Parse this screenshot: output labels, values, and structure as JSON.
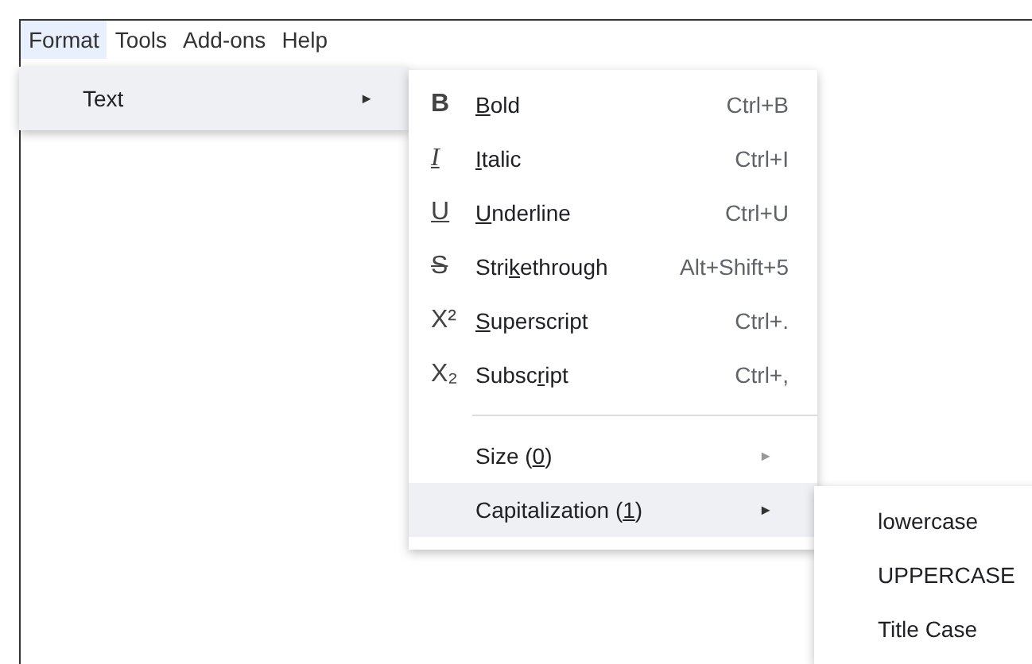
{
  "menubar": [
    {
      "label": "Format",
      "selected": true
    },
    {
      "label": "Tools",
      "selected": false
    },
    {
      "label": "Add-ons",
      "selected": false
    },
    {
      "label": "Help",
      "selected": false
    }
  ],
  "format_menu": [
    {
      "label": "Text",
      "selected": true,
      "arrow": "►"
    }
  ],
  "text_menu": [
    {
      "kind": "item",
      "icon": {
        "kind": "bold",
        "text": "B"
      },
      "key": "B",
      "post": "old",
      "shortcut": "Ctrl+B",
      "selected": false
    },
    {
      "kind": "item",
      "icon": {
        "kind": "italic",
        "text": "I"
      },
      "key": "I",
      "post": "talic",
      "shortcut": "Ctrl+I",
      "selected": false
    },
    {
      "kind": "item",
      "icon": {
        "kind": "underline",
        "text": "U"
      },
      "key": "U",
      "post": "nderline",
      "shortcut": "Ctrl+U",
      "selected": false
    },
    {
      "kind": "item",
      "icon": {
        "kind": "strike",
        "text": "S"
      },
      "pre": "Stri",
      "key": "k",
      "post": "ethrough",
      "shortcut": "Alt+Shift+5",
      "selected": false
    },
    {
      "kind": "item",
      "icon": {
        "kind": "plain",
        "text": "X²"
      },
      "key": "S",
      "post": "uperscript",
      "shortcut": "Ctrl+.",
      "selected": false
    },
    {
      "kind": "item",
      "icon": {
        "kind": "plain",
        "text": "X₂"
      },
      "pre": "Subsc",
      "key": "r",
      "post": "ipt",
      "shortcut": "Ctrl+,",
      "selected": false
    },
    {
      "kind": "separator"
    },
    {
      "kind": "submenu",
      "pre": "Size (",
      "key": "0",
      "post": ")",
      "arrow": "►",
      "selected": false
    },
    {
      "kind": "submenu",
      "pre": "Capitalization (",
      "key": "1",
      "post": ")",
      "arrow": "►",
      "selected": true
    }
  ],
  "capitalization_menu": [
    {
      "label": "lowercase"
    },
    {
      "label": "UPPERCASE"
    },
    {
      "label": "Title Case"
    }
  ]
}
